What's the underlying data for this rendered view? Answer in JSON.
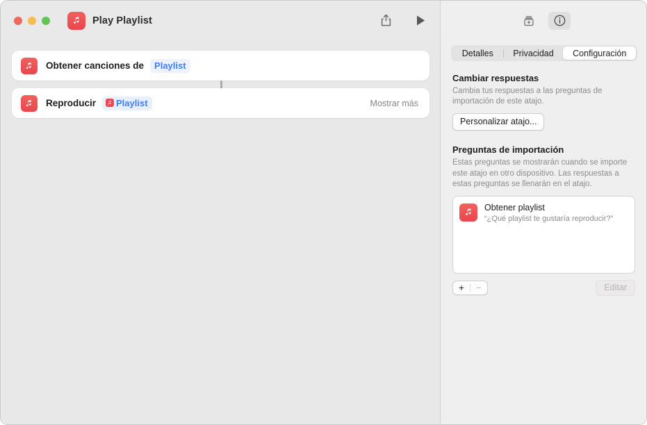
{
  "window": {
    "title": "Play Playlist",
    "app_icon": "music-note-icon",
    "traffic_lights": [
      "close",
      "minimize",
      "zoom"
    ],
    "share_icon": "share-icon",
    "run_icon": "play-icon"
  },
  "canvas": {
    "actions": [
      {
        "icon": "music-note-icon",
        "label": "Obtener canciones de",
        "chip": {
          "type": "plain",
          "label": "Playlist"
        },
        "trailing": ""
      },
      {
        "icon": "music-note-icon",
        "label": "Reproducir",
        "chip": {
          "type": "variable",
          "label": "Playlist",
          "icon": "music-note-icon"
        },
        "trailing": "Mostrar más"
      }
    ]
  },
  "inspector": {
    "toolbar": {
      "add_action_icon": "add-to-library-icon",
      "info_icon": "info-circle-icon"
    },
    "tabs": [
      {
        "label": "Detalles",
        "selected": false
      },
      {
        "label": "Privacidad",
        "selected": false
      },
      {
        "label": "Configuración",
        "selected": true
      }
    ],
    "change_answers": {
      "heading": "Cambiar respuestas",
      "description": "Cambia tus respuestas a las preguntas de importación de este atajo.",
      "button_label": "Personalizar atajo..."
    },
    "import_questions": {
      "heading": "Preguntas de importación",
      "description": "Estas preguntas se mostrarán cuando se importe este atajo en otro dispositivo. Las respuestas a estas preguntas se llenarán en el atajo.",
      "items": [
        {
          "icon": "music-note-icon",
          "title": "Obtener playlist",
          "subtitle": "“¿Qué playlist te gustaría reproducir?”"
        }
      ],
      "add_label": "+",
      "remove_label": "−",
      "edit_label": "Editar"
    }
  },
  "colors": {
    "accent_blue": "#3f7ff5",
    "app_red": "#ea4a53",
    "canvas_bg": "#e8e8e8",
    "panel_bg": "#f0efef"
  }
}
